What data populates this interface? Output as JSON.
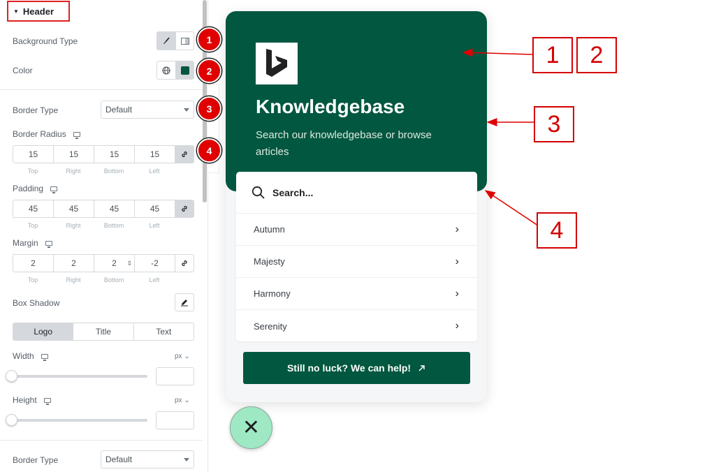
{
  "panel": {
    "section_title": "Header",
    "background_type": {
      "label": "Background Type"
    },
    "color": {
      "label": "Color",
      "swatch_color": "#01573f"
    },
    "border_type": {
      "label": "Border Type",
      "value": "Default"
    },
    "border_radius": {
      "label": "Border Radius",
      "values": [
        "15",
        "15",
        "15",
        "15"
      ]
    },
    "padding": {
      "label": "Padding",
      "values": [
        "45",
        "45",
        "45",
        "45"
      ]
    },
    "margin": {
      "label": "Margin",
      "values": [
        "2",
        "2",
        "2",
        "-2"
      ]
    },
    "dim_labels": [
      "Top",
      "Right",
      "Bottom",
      "Left"
    ],
    "box_shadow": {
      "label": "Box Shadow"
    },
    "tabs": [
      "Logo",
      "Title",
      "Text"
    ],
    "active_tab": "Logo",
    "width": {
      "label": "Width",
      "unit": "px"
    },
    "height": {
      "label": "Height",
      "unit": "px"
    },
    "border_type_2": {
      "label": "Border Type",
      "value": "Default"
    }
  },
  "badges": [
    "1",
    "2",
    "3",
    "4"
  ],
  "preview": {
    "title": "Knowledgebase",
    "subtitle": "Search our knowledgebase or browse articles",
    "search_placeholder": "Search...",
    "items": [
      "Autumn",
      "Majesty",
      "Harmony",
      "Serenity"
    ],
    "cta": "Still no luck? We can help!",
    "header_color": "#01573f",
    "close_color": "#9ee8c4"
  },
  "callouts": [
    "1",
    "2",
    "3",
    "4"
  ],
  "icons": [
    "caret-down-icon",
    "brush-icon",
    "gradient-icon",
    "globe-icon",
    "desktop-icon",
    "link-icon",
    "pencil-icon",
    "search-icon",
    "chevron-right-icon",
    "arrow-up-right-icon",
    "close-icon",
    "logo-icon"
  ]
}
